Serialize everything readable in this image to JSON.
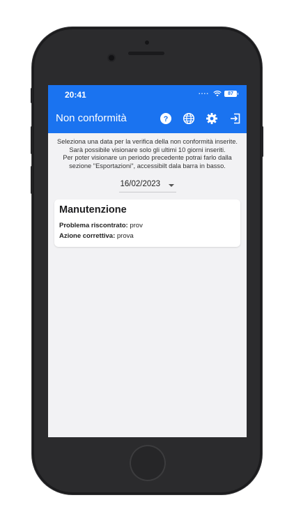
{
  "status_bar": {
    "time": "20:41",
    "signal_dots": "....",
    "battery": "87"
  },
  "app_bar": {
    "title": "Non conformità",
    "icons": [
      "help-icon",
      "globe-icon",
      "gear-icon",
      "logout-icon"
    ]
  },
  "info": {
    "line1": "Seleziona una data per la verifica della non conformità inserite. Sarà possibile visionare solo gli ultimi 10 giorni inseriti.",
    "line2": "Per poter visionare un periodo precedente potrai farlo dalla sezione \"Esportazioni\", accessibilt dala barra in basso."
  },
  "date_picker": {
    "value": "16/02/2023"
  },
  "cards": [
    {
      "title": "Manutenzione",
      "problem_label": "Problema riscontrato:",
      "problem_value": "prov",
      "action_label": "Azione correttiva:",
      "action_value": "prova"
    }
  ],
  "colors": {
    "primary": "#1a73f0",
    "background": "#f2f2f4",
    "frame": "#2b2b2d"
  }
}
